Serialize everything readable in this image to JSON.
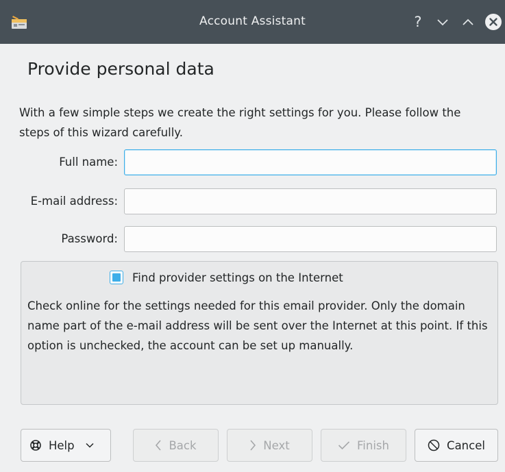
{
  "window": {
    "title": "Account Assistant",
    "controls": {
      "help": "?",
      "minimize": "chevron-down",
      "maximize": "chevron-up",
      "close": "close"
    }
  },
  "page": {
    "heading": "Provide personal data",
    "intro": "With a few simple steps we create the right settings for you. Please follow the steps of this wizard carefully."
  },
  "form": {
    "full_name": {
      "label": "Full name:",
      "value": "",
      "placeholder": ""
    },
    "email": {
      "label": "E-mail address:",
      "value": "",
      "placeholder": ""
    },
    "password": {
      "label": "Password:",
      "value": "",
      "placeholder": ""
    }
  },
  "provider": {
    "checkbox_label": "Find provider settings on the Internet",
    "checked": true,
    "description": "Check online for the settings needed for this email provider. Only the domain name part of the e-mail address will be sent over the Internet at this point. If this option is unchecked, the account can be set up manually."
  },
  "buttons": {
    "help": "Help",
    "back": "Back",
    "next": "Next",
    "finish": "Finish",
    "cancel": "Cancel"
  },
  "colors": {
    "titlebar": "#475057",
    "accent": "#3daee9",
    "background": "#eff0f1",
    "close_circle": "#eff0f1"
  }
}
